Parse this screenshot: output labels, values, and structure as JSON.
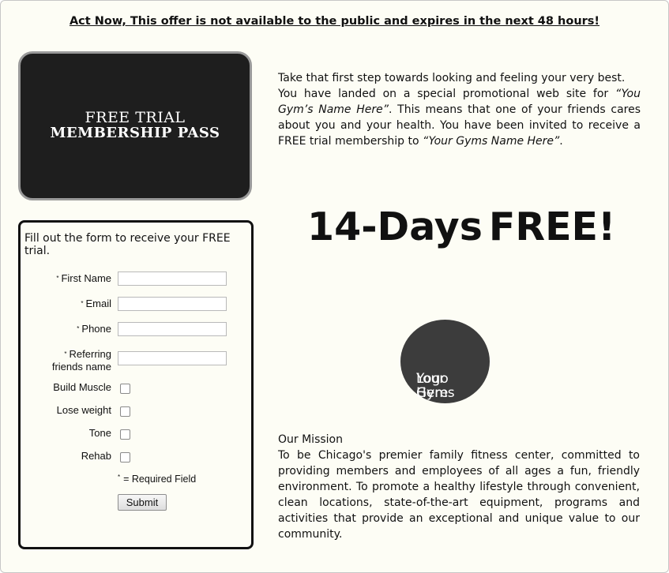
{
  "offer_banner": "Act Now, This offer is not available to the public and expires in the next 48 hours!",
  "pass": {
    "line1": "FREE TRIAL",
    "line2": "MEMBERSHIP PASS"
  },
  "intro": {
    "p1": "Take that first step towards looking and feeling your very best.",
    "p2_a": "You have landed on a special promotional web site for ",
    "p2_em1": "“You Gym’s Name Here”",
    "p2_b": ". This means that one of your friends cares about you and your health. You have been invited to receive a FREE trial membership to ",
    "p2_em2": "“Your Gyms Name Here”",
    "p2_c": "."
  },
  "headline": {
    "days": "14-Days",
    "free": "FREE!"
  },
  "logo": {
    "line1": "Your Gyms",
    "line2": "Logo Here"
  },
  "mission": {
    "title": "Our Mission",
    "text": "To be Chicago's premier family fitness center, committed to providing members and employees of all ages a fun, friendly environment. To promote a healthy lifestyle through convenient, clean locations, state-of-the-art equipment, programs and activities that provide an exceptional and unique value to our community."
  },
  "form": {
    "title": "Fill out the form to receive your FREE trial.",
    "required_marker": "*",
    "first_name_label": "First Name",
    "email_label": "Email",
    "phone_label": "Phone",
    "referring_label_1": "Referring",
    "referring_label_2": "friends name",
    "first_name_value": "",
    "email_value": "",
    "phone_value": "",
    "referring_value": "",
    "build_muscle_label": "Build Muscle",
    "lose_weight_label": "Lose weight",
    "tone_label": "Tone",
    "rehab_label": "Rehab",
    "required_note": "= Required Field",
    "submit_label": "Submit"
  }
}
